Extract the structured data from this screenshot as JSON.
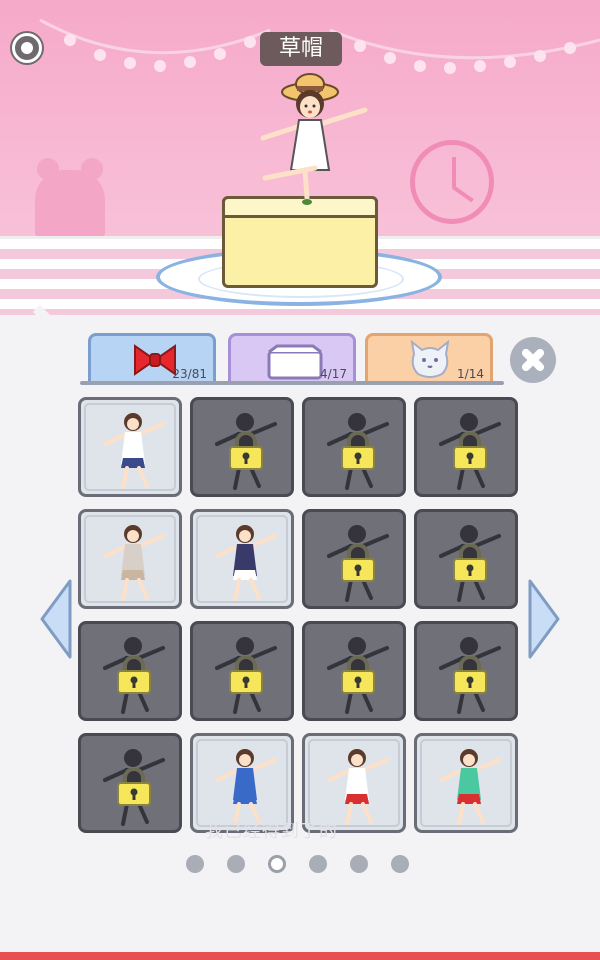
{
  "header": {
    "title": "草帽"
  },
  "tabs": [
    {
      "name": "bow",
      "count": "23/81",
      "color": "#b7d4f4"
    },
    {
      "name": "box",
      "count": "4/17",
      "color": "#d9c8f4"
    },
    {
      "name": "cat",
      "count": "1/14",
      "color": "#fcd0a6"
    }
  ],
  "grid": {
    "cells": [
      {
        "state": "unlocked",
        "icon": "schoolgirl-outfit"
      },
      {
        "state": "locked",
        "icon": "silhouette-figure"
      },
      {
        "state": "locked",
        "icon": "vegetable-figure"
      },
      {
        "state": "locked",
        "icon": "crow-figure"
      },
      {
        "state": "unlocked",
        "icon": "casual-outfit"
      },
      {
        "state": "unlocked",
        "icon": "tracksuit-outfit"
      },
      {
        "state": "locked",
        "icon": "broom-figure"
      },
      {
        "state": "locked",
        "icon": "kimono-figure"
      },
      {
        "state": "locked",
        "icon": "fan-figure"
      },
      {
        "state": "locked",
        "icon": "yellow-figure"
      },
      {
        "state": "locked",
        "icon": "frog-figure"
      },
      {
        "state": "locked",
        "icon": "spear-figure"
      },
      {
        "state": "locked",
        "icon": "mummy-figure"
      },
      {
        "state": "unlocked",
        "icon": "blue-jersey-outfit"
      },
      {
        "state": "unlocked",
        "icon": "chef-outfit"
      },
      {
        "state": "unlocked",
        "icon": "painter-outfit"
      }
    ]
  },
  "faint_text": "我已经得到了的",
  "pagination": {
    "total": 6,
    "active_index": 2
  },
  "colors": {
    "accent_pink": "#f6a9c9",
    "lock_yellow": "#f5e65a",
    "bottom_bar": "#e8514f"
  }
}
